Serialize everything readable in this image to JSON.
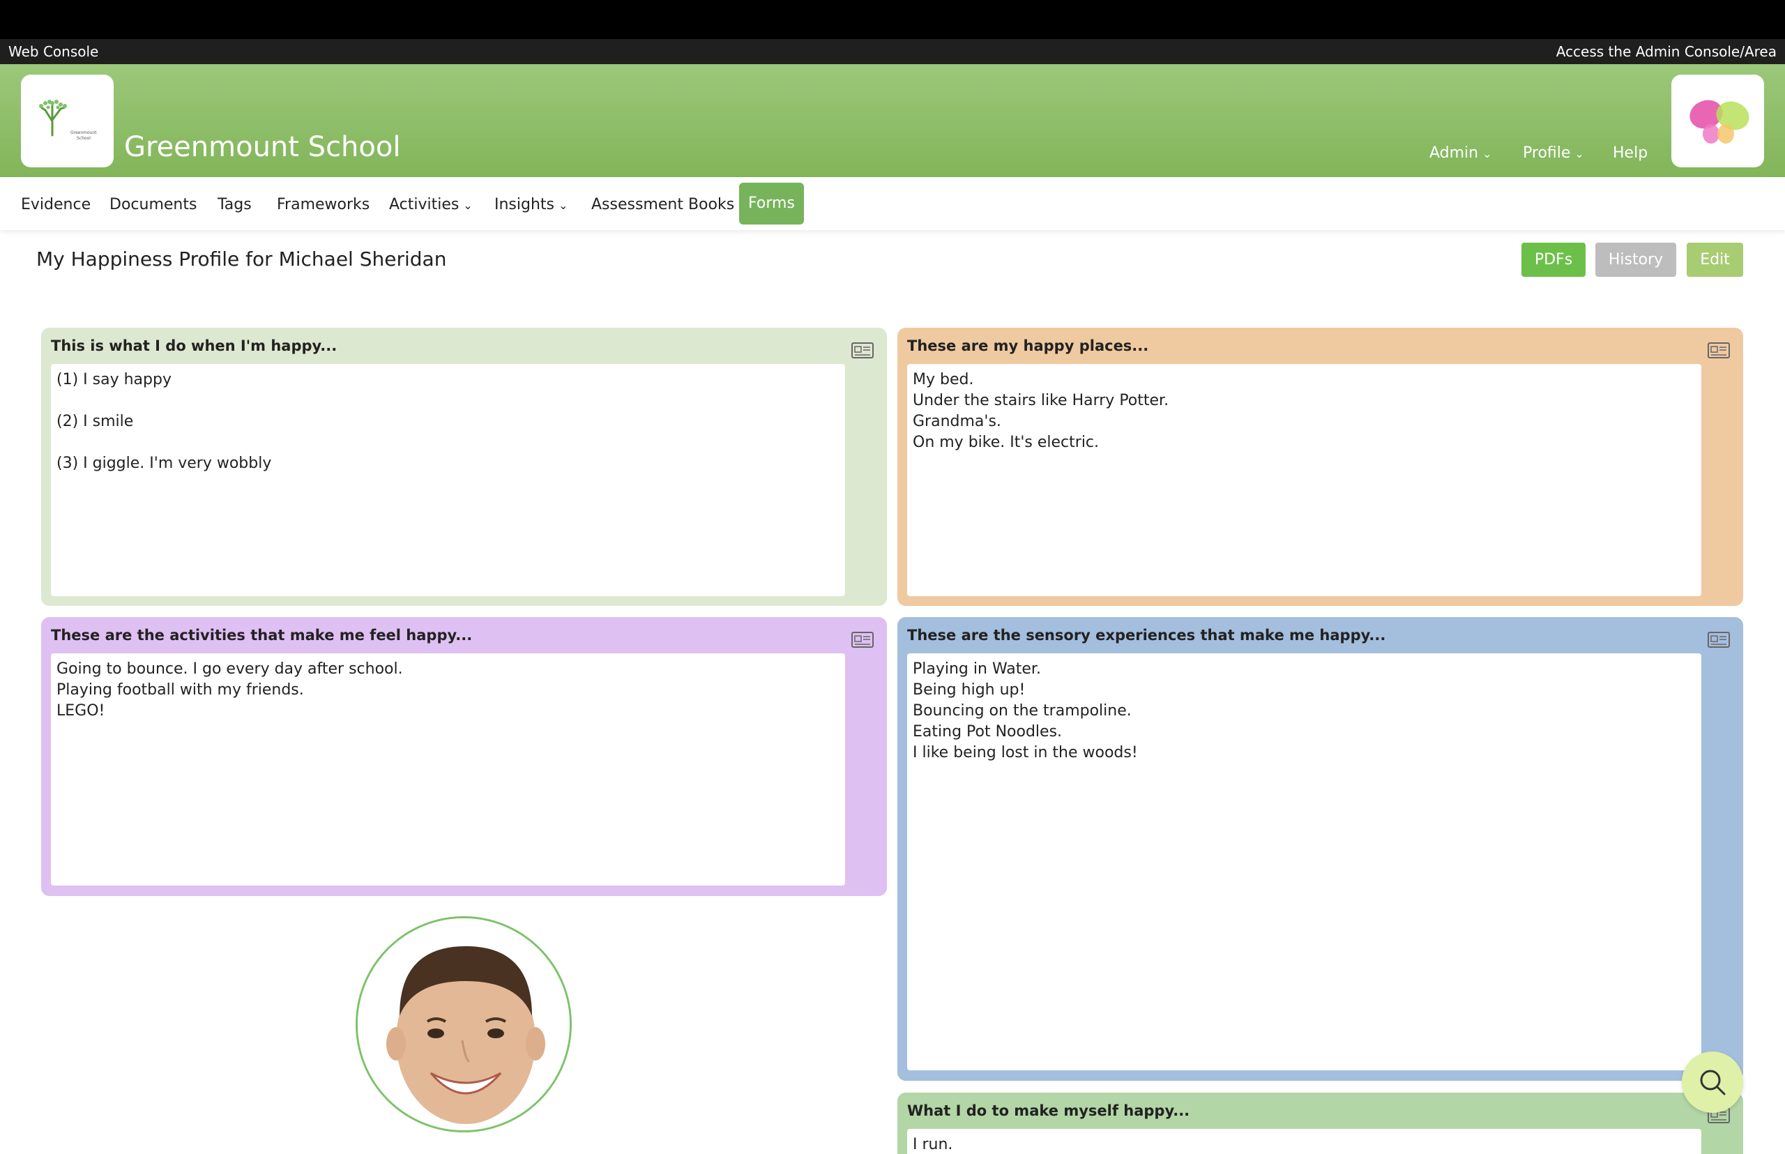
{
  "console_bar": {
    "left": "Web Console",
    "right": "Access the Admin Console/Area"
  },
  "header": {
    "school_name": "Greenmount School",
    "logo_text_line1": "Greenmount",
    "logo_text_line2": "School",
    "nav": {
      "admin": "Admin",
      "profile": "Profile",
      "help": "Help"
    }
  },
  "navbar": {
    "evidence": "Evidence",
    "documents": "Documents",
    "tags": "Tags",
    "frameworks": "Frameworks",
    "activities": "Activities",
    "insights": "Insights",
    "assessment_books": "Assessment Books",
    "forms": "Forms"
  },
  "page": {
    "title": "My Happiness Profile for Michael Sheridan",
    "buttons": {
      "pdfs": "PDFs",
      "history": "History",
      "edit": "Edit"
    }
  },
  "cards": {
    "happy_do": {
      "title": "This is what I do when I'm happy...",
      "lines": [
        "(1) I say happy",
        "",
        "(2) I smile",
        "",
        "(3) I giggle. I'm very wobbly"
      ]
    },
    "happy_places": {
      "title": "These are my happy places...",
      "lines": [
        "My bed.",
        "Under the stairs like Harry Potter.",
        "Grandma's.",
        "On my bike. It's electric."
      ]
    },
    "activities": {
      "title": "These are the activities that make me feel happy...",
      "lines": [
        "Going to bounce. I go every day after school.",
        "Playing football with my friends.",
        "LEGO!"
      ]
    },
    "sensory": {
      "title": "These are the sensory experiences that make me happy...",
      "lines": [
        "Playing in Water.",
        "Being high up!",
        "Bouncing on the trampoline.",
        "Eating Pot Noodles.",
        "I like being lost in the woods!"
      ]
    },
    "make_happy": {
      "title": "What I do to make myself happy...",
      "lines": [
        "I run."
      ]
    }
  },
  "colors": {
    "header_green": "#8fc06a",
    "forms_active": "#77b35a",
    "pdfs_button": "#6cc04a",
    "history_button": "#bdbdbd",
    "edit_button": "#a8cc72",
    "card_green": "#dde8d0",
    "card_orange": "#efcaa0",
    "card_purple": "#dfc0f2",
    "card_blue": "#a4bedd",
    "card_green2": "#b2d6a6"
  },
  "icons": {
    "card_icon": "newspaper-icon",
    "fab": "search-icon"
  }
}
